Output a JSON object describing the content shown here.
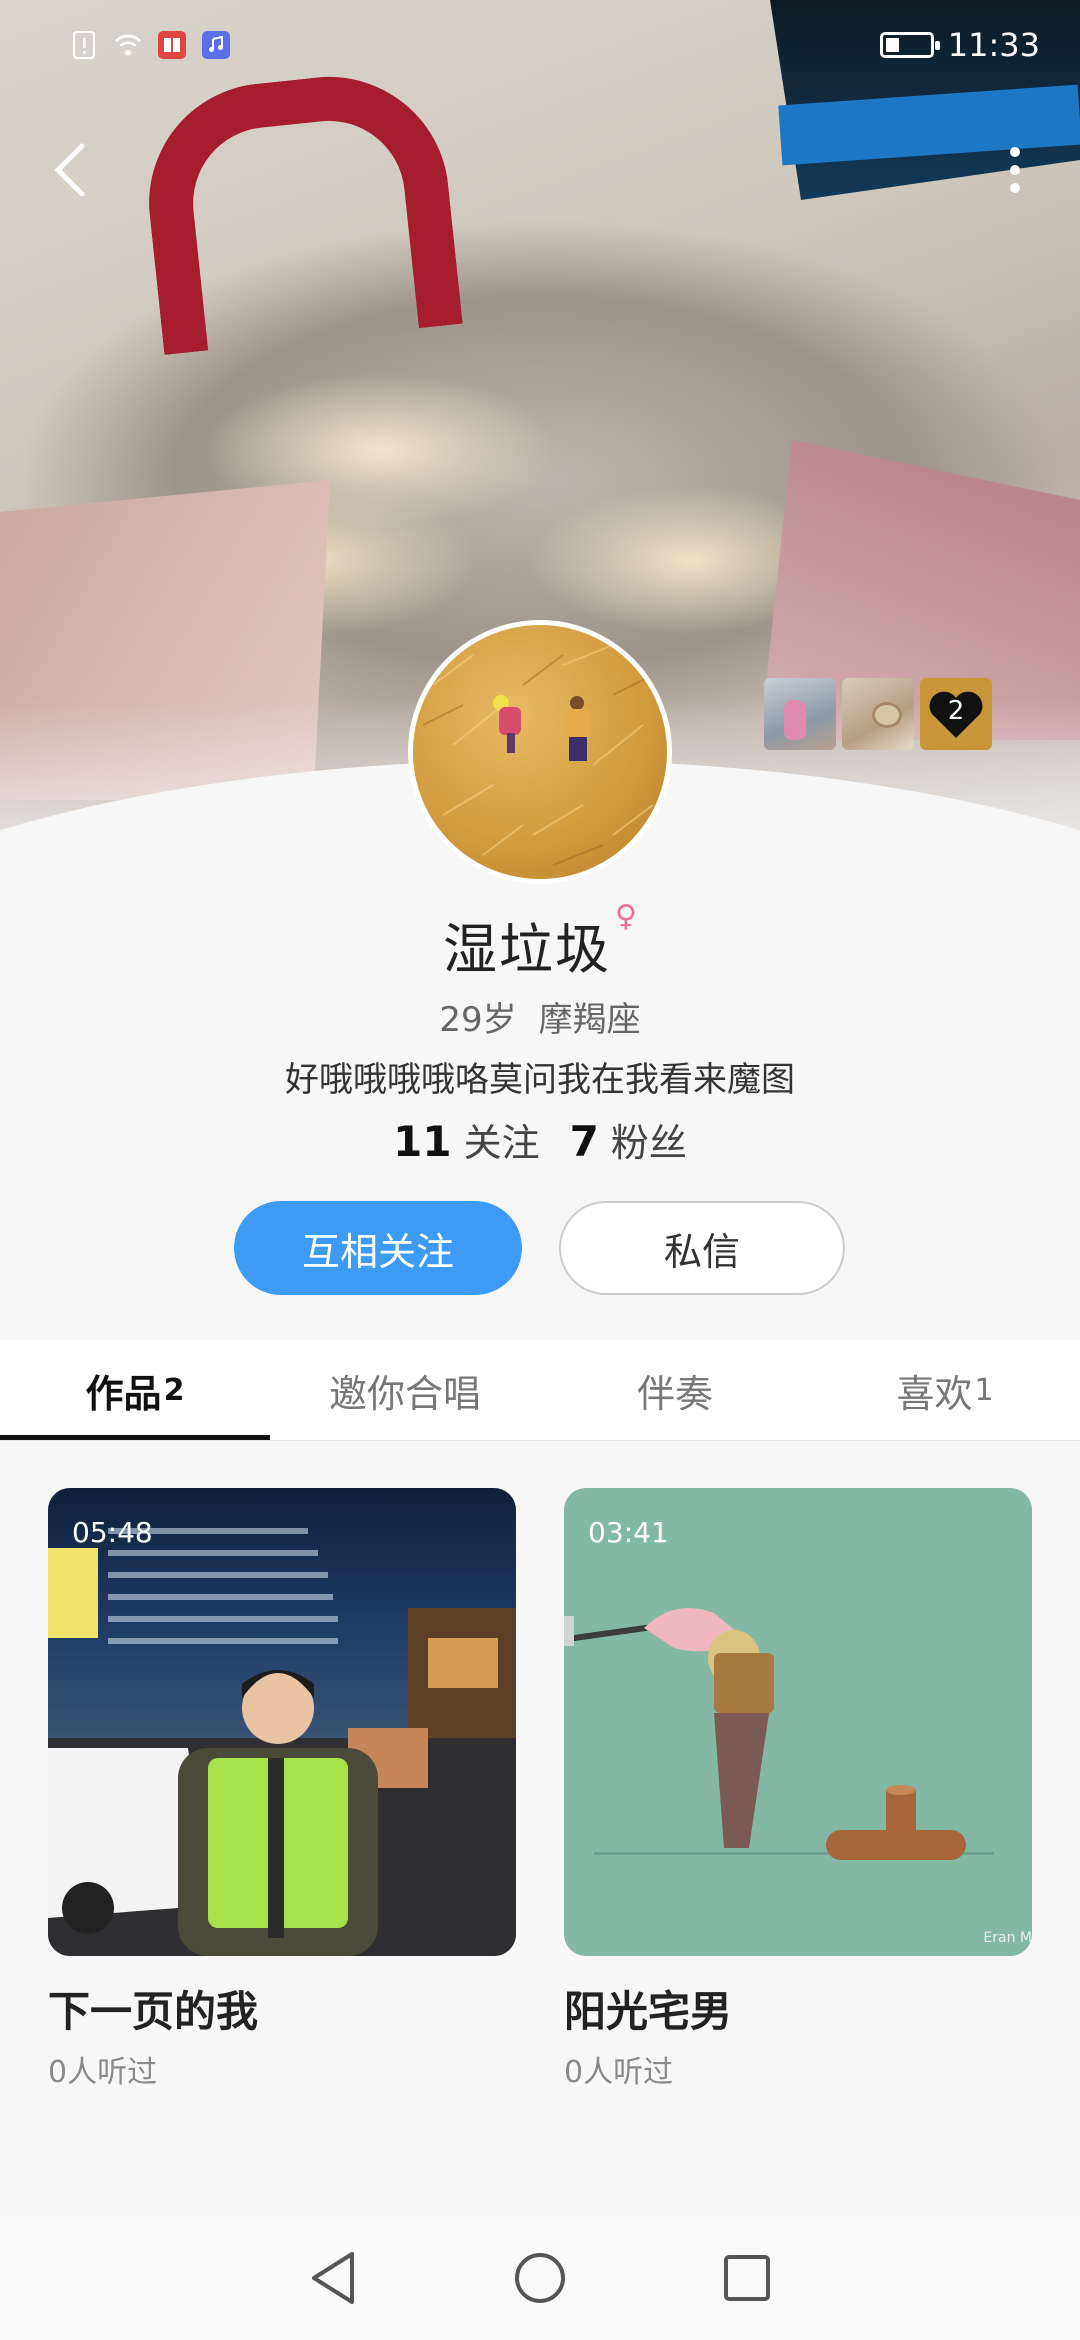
{
  "status_bar": {
    "time": "11:33",
    "icons": [
      "sim-alert-icon",
      "wifi-icon",
      "book-app-icon",
      "music-app-icon"
    ]
  },
  "profile": {
    "nickname": "湿垃圾",
    "gender": "female",
    "gender_symbol": "♀",
    "age": "29岁",
    "zodiac": "摩羯座",
    "bio": "好哦哦哦哦咯莫问我在我看来魔图",
    "following_count": "11",
    "following_label": "关注",
    "followers_count": "7",
    "followers_label": "粉丝",
    "visitors_badge": "2"
  },
  "actions": {
    "follow_label": "互相关注",
    "message_label": "私信",
    "follow_color": "#3d9bf6"
  },
  "tabs": [
    {
      "label": "作品",
      "count": "2",
      "active": true
    },
    {
      "label": "邀你合唱",
      "count": "",
      "active": false
    },
    {
      "label": "伴奏",
      "count": "",
      "active": false
    },
    {
      "label": "喜欢",
      "count": "1",
      "active": false
    }
  ],
  "works": [
    {
      "duration": "05:48",
      "title": "下一页的我",
      "listens": "0人听过"
    },
    {
      "duration": "03:41",
      "title": "阳光宅男",
      "listens": "0人听过",
      "credit": "Eran M"
    }
  ],
  "nav_bar": {
    "icons": [
      "back-triangle-icon",
      "home-circle-icon",
      "recents-square-icon"
    ]
  }
}
